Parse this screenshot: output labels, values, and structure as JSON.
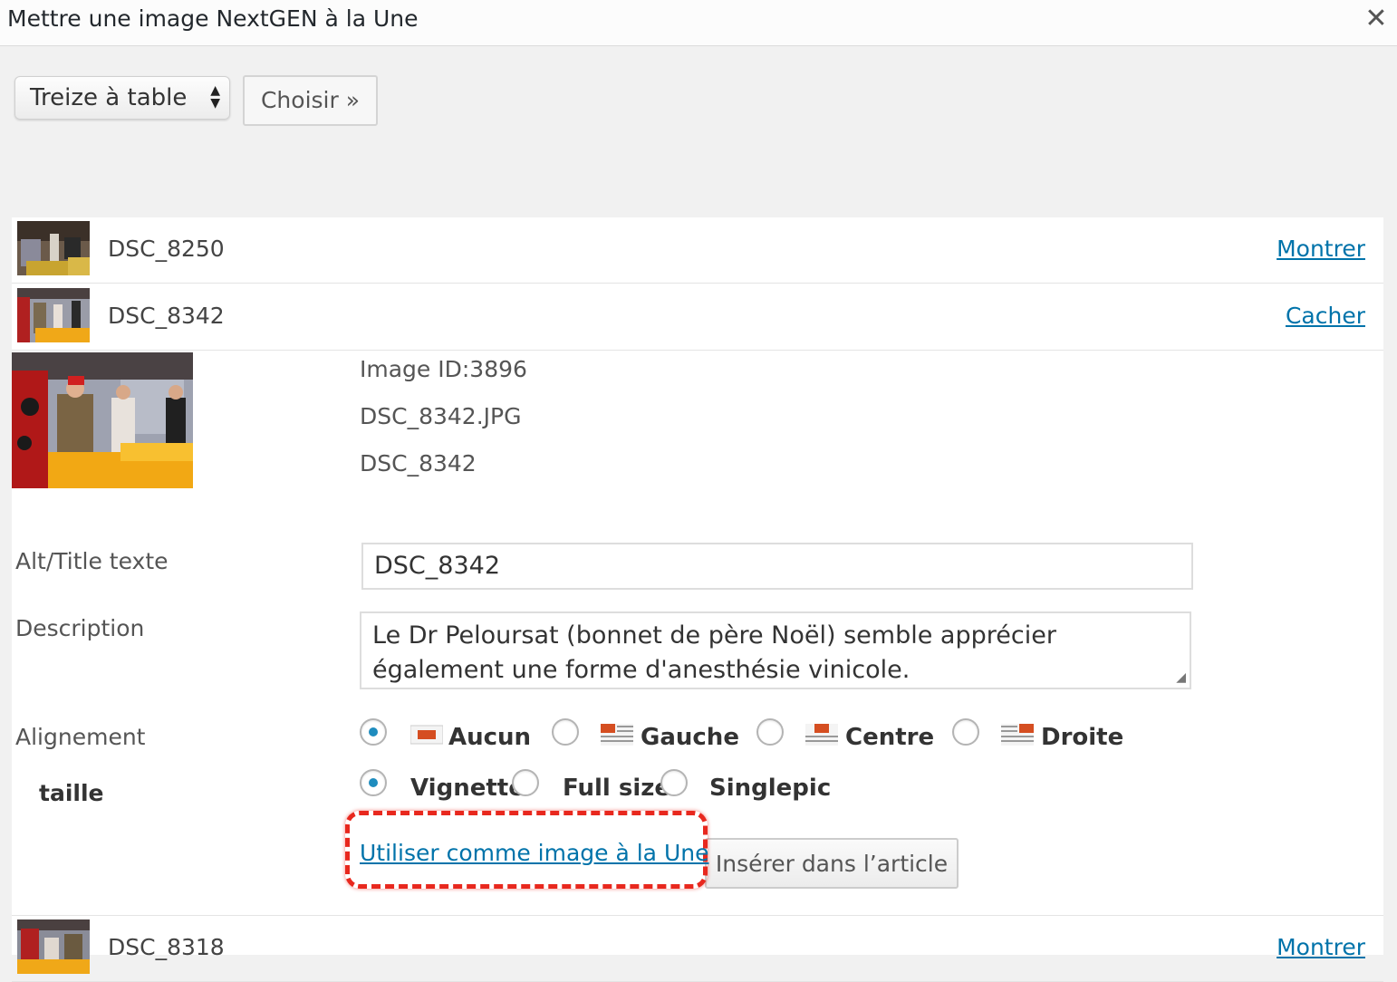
{
  "dialog": {
    "title": "Mettre une image NextGEN à la Une",
    "close_icon": "close-icon"
  },
  "toolbar": {
    "gallery_select": "Treize à table",
    "choose_button": "Choisir »"
  },
  "images": [
    {
      "name": "DSC_8250",
      "toggle": "Montrer"
    },
    {
      "name": "DSC_8342",
      "toggle": "Cacher"
    },
    {
      "name": "DSC_8318",
      "toggle": "Montrer"
    }
  ],
  "detail": {
    "image_id": "Image ID:3896",
    "filename": "DSC_8342.JPG",
    "title": "DSC_8342",
    "alt_label": "Alt/Title texte",
    "alt_value": "DSC_8342",
    "description_label": "Description",
    "description_value": "Le Dr Peloursat (bonnet de père Noël) semble apprécier également une forme d'anesthésie vinicole.",
    "alignment_label": "Alignement",
    "alignment_options": [
      "Aucun",
      "Gauche",
      "Centre",
      "Droite"
    ],
    "alignment_selected": "Aucun",
    "size_label": "taille",
    "size_options": [
      "Vignette",
      "Full size",
      "Singlepic"
    ],
    "size_selected": "Vignette",
    "featured_link": "Utiliser comme image à la Une",
    "insert_button": "Insérer dans l’article"
  },
  "colors": {
    "link": "#0073aa",
    "highlight": "#e8281e",
    "radio_selected": "#1e8cbe"
  }
}
